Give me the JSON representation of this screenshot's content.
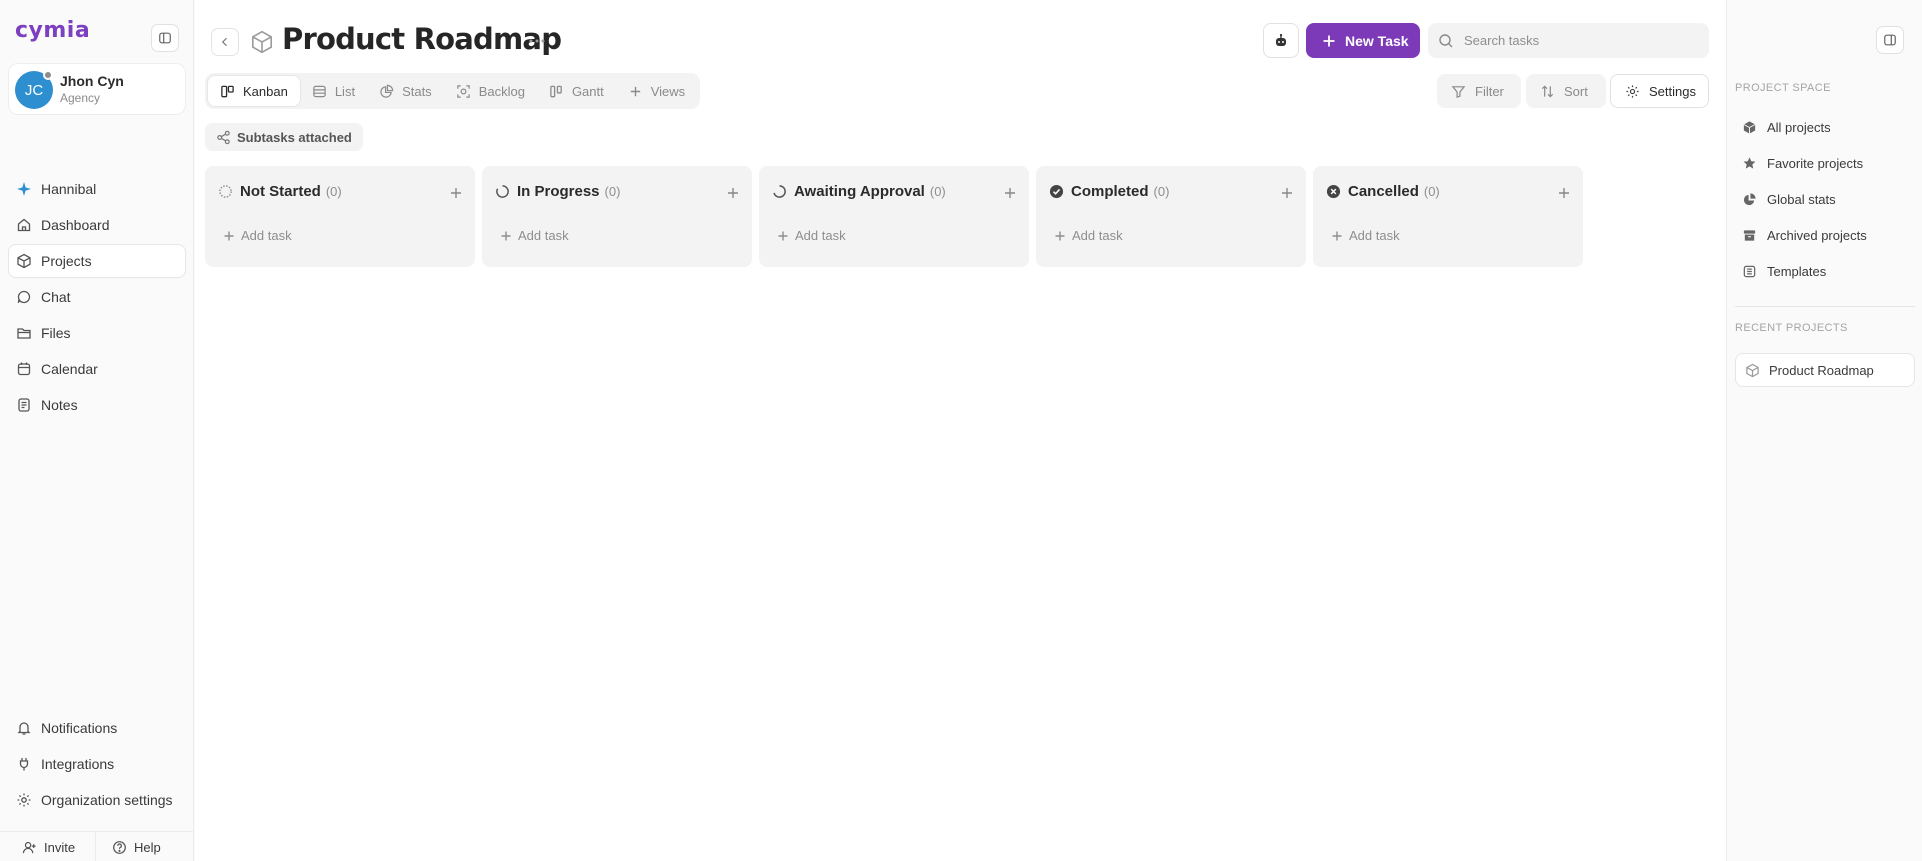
{
  "app": {
    "logo_text": "cymia"
  },
  "user": {
    "initials": "JC",
    "name": "Jhon Cyn",
    "role": "Agency"
  },
  "sidebar": {
    "items": [
      {
        "label": "Hannibal",
        "icon": "sparkle-icon"
      },
      {
        "label": "Dashboard",
        "icon": "home-icon"
      },
      {
        "label": "Projects",
        "icon": "box-icon",
        "active": true
      },
      {
        "label": "Chat",
        "icon": "chat-icon"
      },
      {
        "label": "Files",
        "icon": "folder-icon"
      },
      {
        "label": "Calendar",
        "icon": "calendar-icon"
      },
      {
        "label": "Notes",
        "icon": "notes-icon"
      }
    ],
    "bottom_items": [
      {
        "label": "Notifications",
        "icon": "bell-icon"
      },
      {
        "label": "Integrations",
        "icon": "plug-icon"
      },
      {
        "label": "Organization settings",
        "icon": "gear-icon"
      }
    ],
    "footer": {
      "invite": "Invite",
      "help": "Help"
    }
  },
  "header": {
    "title": "Product Roadmap",
    "new_task": "New Task",
    "search_placeholder": "Search tasks"
  },
  "views": {
    "tabs": [
      {
        "label": "Kanban",
        "icon": "kanban-icon",
        "active": true
      },
      {
        "label": "List",
        "icon": "list-icon"
      },
      {
        "label": "Stats",
        "icon": "pie-chart-icon"
      },
      {
        "label": "Backlog",
        "icon": "backlog-icon"
      },
      {
        "label": "Gantt",
        "icon": "gantt-icon"
      },
      {
        "label": "Views",
        "icon": "plus-icon"
      }
    ]
  },
  "toolbar": {
    "filter": "Filter",
    "sort": "Sort",
    "settings": "Settings"
  },
  "chip": {
    "label": "Subtasks attached"
  },
  "board": {
    "columns": [
      {
        "title": "Not Started",
        "count": "(0)",
        "add": "Add task",
        "status": "not-started"
      },
      {
        "title": "In Progress",
        "count": "(0)",
        "add": "Add task",
        "status": "in-progress"
      },
      {
        "title": "Awaiting Approval",
        "count": "(0)",
        "add": "Add task",
        "status": "awaiting"
      },
      {
        "title": "Completed",
        "count": "(0)",
        "add": "Add task",
        "status": "completed"
      },
      {
        "title": "Cancelled",
        "count": "(0)",
        "add": "Add task",
        "status": "cancelled"
      }
    ]
  },
  "right_sidebar": {
    "section_project_space": "PROJECT SPACE",
    "items": [
      {
        "label": "All projects",
        "icon": "cube-icon"
      },
      {
        "label": "Favorite projects",
        "icon": "star-icon"
      },
      {
        "label": "Global stats",
        "icon": "pie-chart-icon"
      },
      {
        "label": "Archived projects",
        "icon": "archive-icon"
      },
      {
        "label": "Templates",
        "icon": "template-icon"
      }
    ],
    "section_recent": "RECENT PROJECTS",
    "recent": [
      {
        "label": "Product Roadmap",
        "icon": "cube-icon"
      }
    ]
  },
  "colors": {
    "accent": "#7d3ab8",
    "avatar": "#2e8fd0",
    "brand": "#7b3fbf"
  }
}
